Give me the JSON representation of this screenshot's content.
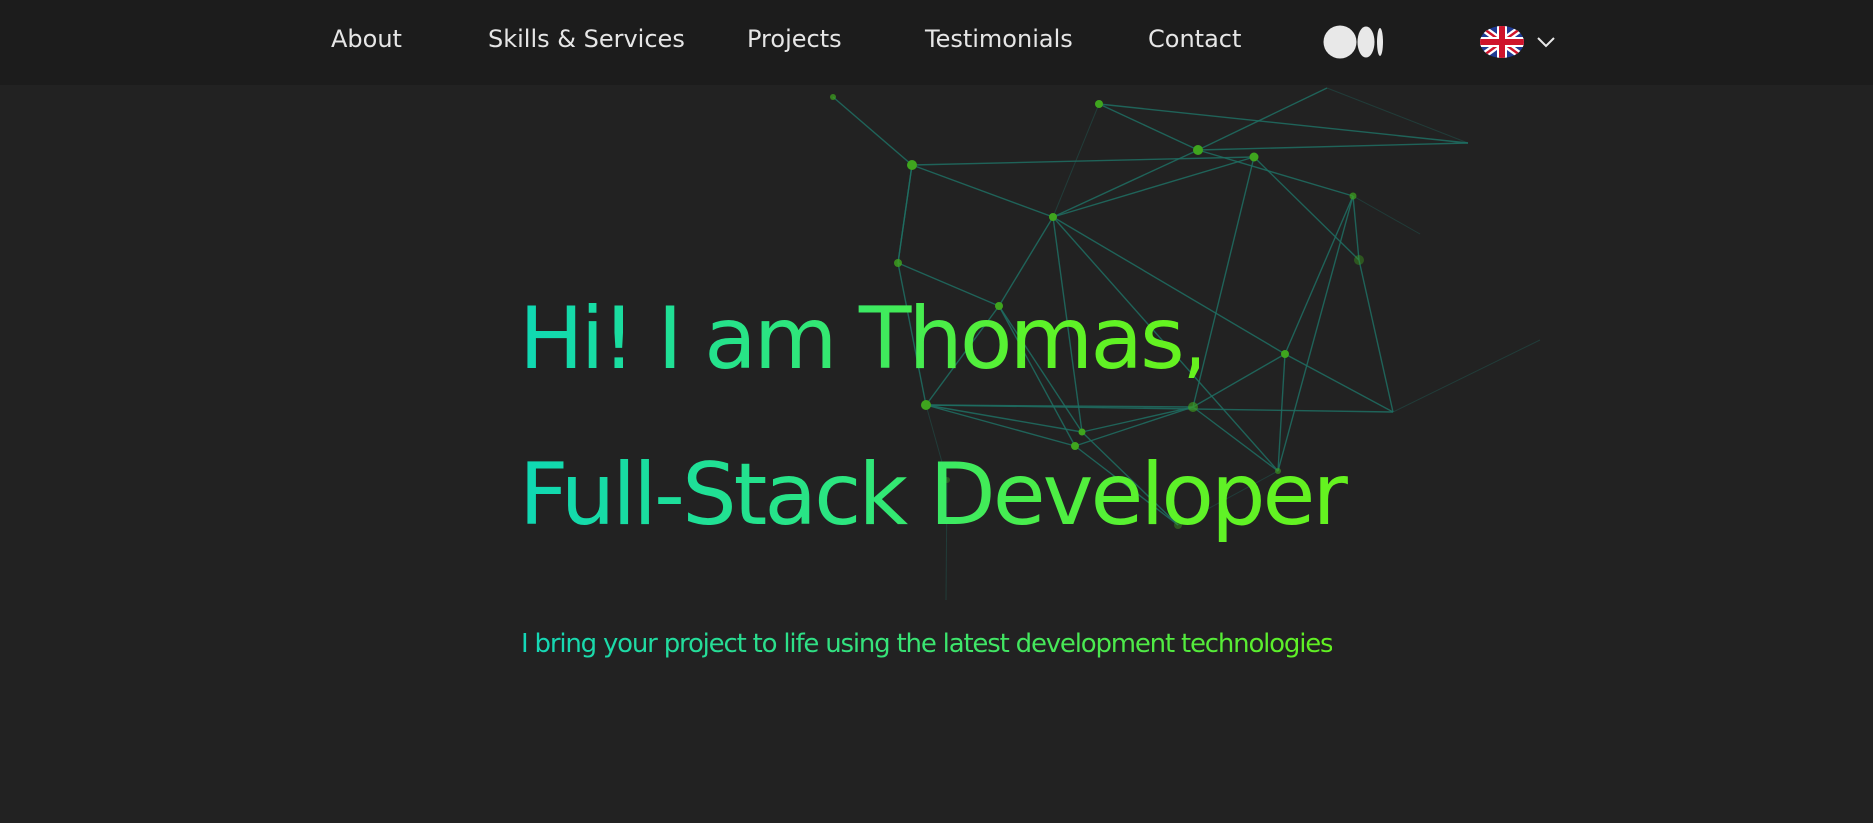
{
  "nav": {
    "items": [
      {
        "label": "About"
      },
      {
        "label": "Skills & Services"
      },
      {
        "label": "Projects"
      },
      {
        "label": "Testimonials"
      },
      {
        "label": "Contact"
      }
    ],
    "icons": {
      "medium": "medium-logo-icon",
      "language_flag": "uk-flag-icon",
      "dropdown": "chevron-down-icon"
    }
  },
  "hero": {
    "line1": "Hi! I am Thomas,",
    "line2": "Full-Stack Developer",
    "tagline": "I bring your project to life using the latest development technologies"
  },
  "colors": {
    "background": "#222222",
    "navbar": "#1c1c1c",
    "nav_text": "#e6e6e6",
    "gradient_start": "#0fd8b4",
    "gradient_end": "#66f21e",
    "network_line": "#1f6e63",
    "network_node": "#3fa51e"
  }
}
